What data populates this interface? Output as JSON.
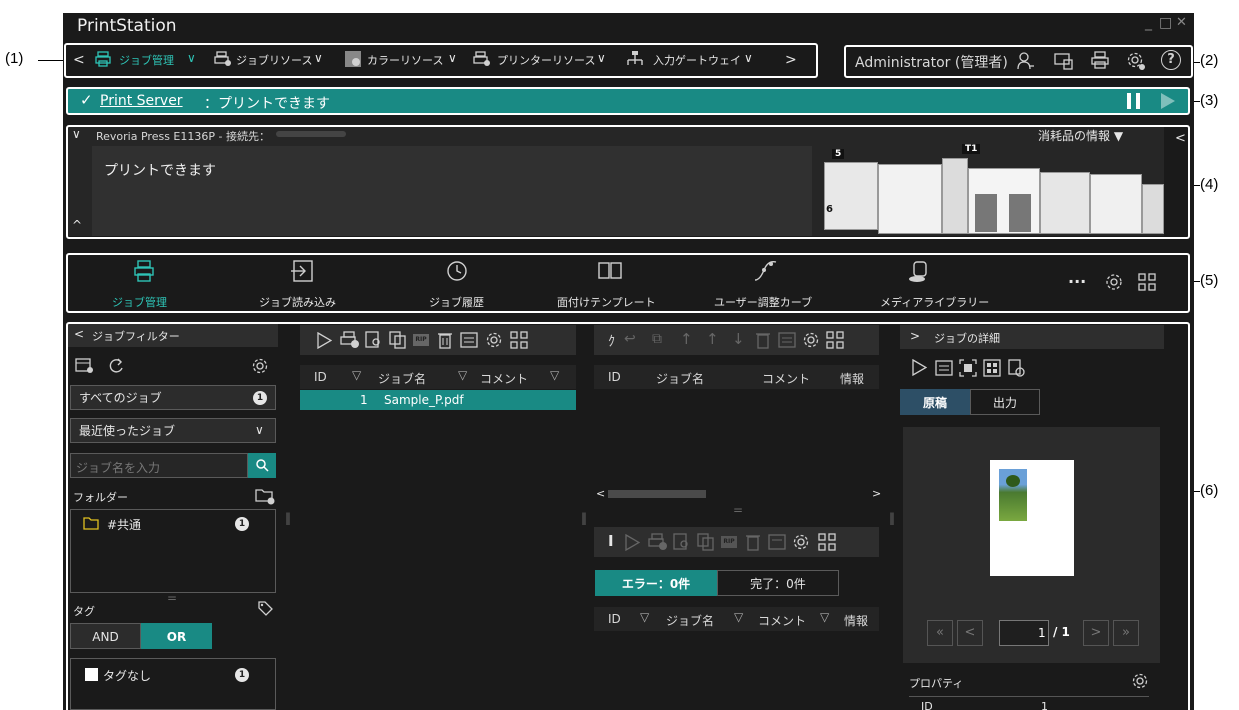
{
  "callouts": {
    "c1": "(1)",
    "c2": "(2)",
    "c3": "(3)",
    "c4": "(4)",
    "c5": "(5)",
    "c6": "(6)"
  },
  "app": {
    "title": "PrintStation",
    "win_min": "_",
    "win_max": "□",
    "win_close": "✕"
  },
  "nav": {
    "items": [
      {
        "label": "ジョブ管理",
        "icon": "printer-icon"
      },
      {
        "label": "ジョブリソース",
        "icon": "printer-gear-icon"
      },
      {
        "label": "カラーリソース",
        "icon": "color-resource-icon"
      },
      {
        "label": "プリンターリソース",
        "icon": "printer-settings-icon"
      },
      {
        "label": "入力ゲートウェイ",
        "icon": "gateway-icon"
      }
    ],
    "chevron": "∨",
    "left": "<",
    "right": ">"
  },
  "user": {
    "name": "Administrator (管理者)",
    "help": "?"
  },
  "status": {
    "server": "Print Server",
    "message": "：プリントできます",
    "check": "✓"
  },
  "printer": {
    "name": "Revoria Press E1136P - 接続先：",
    "supplies": "消耗品の情報 ▼",
    "state": "プリントできます",
    "tray5": "5",
    "tray6": "6",
    "trayT1": "T1"
  },
  "toolbar": {
    "items": [
      "ジョブ管理",
      "ジョブ読み込み",
      "ジョブ履歴",
      "面付けテンプレート",
      "ユーザー調整カーブ",
      "メディアライブラリー"
    ],
    "more": "···"
  },
  "filter": {
    "header": "ジョブフィルター",
    "all_jobs": "すべてのジョブ",
    "all_count": "1",
    "recent": "最近使ったジョブ",
    "search_placeholder": "ジョブ名を入力",
    "folder_label": "フォルダー",
    "folder_item": "#共通",
    "folder_count": "1",
    "tag_label": "タグ",
    "and": "AND",
    "or": "OR",
    "no_tag": "タグなし",
    "no_tag_count": "1"
  },
  "joblist": {
    "cols": [
      "ID",
      "ジョブ名",
      "コメント"
    ],
    "rows": [
      {
        "id": "1",
        "name": "Sample_P.pdf"
      }
    ]
  },
  "queue": {
    "cols": [
      "ID",
      "ジョブ名",
      "コメント",
      "情報"
    ]
  },
  "history": {
    "err_tab": "エラー：0件",
    "done_tab": "完了：0件",
    "cols": [
      "ID",
      "ジョブ名",
      "コメント",
      "情報"
    ]
  },
  "detail": {
    "header": "ジョブの詳細",
    "tab_original": "原稿",
    "tab_output": "出力",
    "page_current": "1",
    "page_total": "/ 1",
    "props": "プロパティ",
    "prop_id": "ID",
    "prop_id_val": "1"
  },
  "colors": {
    "accent": "#198a84",
    "bg": "#1a1a1a"
  }
}
